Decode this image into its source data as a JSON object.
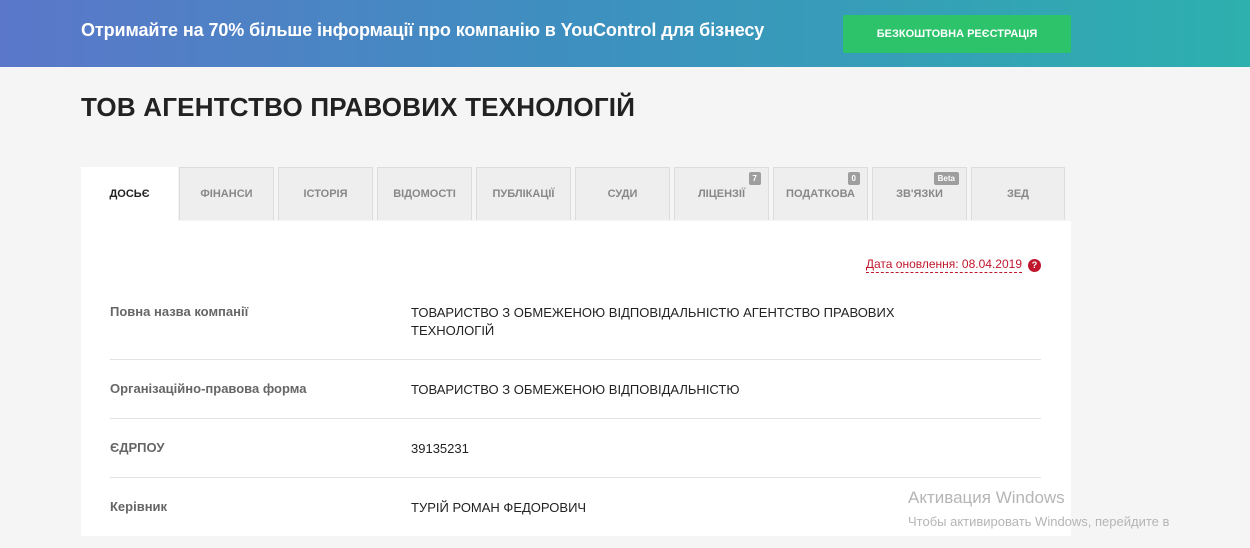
{
  "banner": {
    "text": "Отримайте на 70% більше інформації про компанію в YouControl для бізнесу",
    "button_label": "Безкоштовна реєстрація"
  },
  "company": {
    "title": "ТОВ АГЕНТСТВО ПРАВОВИХ ТЕХНОЛОГІЙ"
  },
  "tabs": [
    {
      "label": "Досьє",
      "active": true
    },
    {
      "label": "Фінанси"
    },
    {
      "label": "Історія"
    },
    {
      "label": "Відомості"
    },
    {
      "label": "Публікації"
    },
    {
      "label": "Суди"
    },
    {
      "label": "Ліцензії",
      "badge": "7"
    },
    {
      "label": "Податкова",
      "badge": "0"
    },
    {
      "label": "Зв'язки",
      "badge": "Beta"
    },
    {
      "label": "ЗЕД"
    }
  ],
  "panel": {
    "updated_text": "Дата оновлення: 08.04.2019",
    "help_glyph": "?",
    "rows": [
      {
        "label": "Повна назва компанії",
        "value": "ТОВАРИСТВО З ОБМЕЖЕНОЮ ВІДПОВІДАЛЬНІСТЮ АГЕНТСТВО ПРАВОВИХ ТЕХНОЛОГІЙ"
      },
      {
        "label": "Організаційно-правова форма",
        "value": "ТОВАРИСТВО З ОБМЕЖЕНОЮ ВІДПОВІДАЛЬНІСТЮ"
      },
      {
        "label": "ЄДРПОУ",
        "value": "39135231"
      },
      {
        "label": "Керівник",
        "value": "ТУРІЙ РОМАН ФЕДОРОВИЧ"
      }
    ]
  },
  "watermark": {
    "title": "Активация Windows",
    "text": "Чтобы активировать Windows, перейдите в"
  },
  "colors": {
    "banner_start": "#5b77c9",
    "banner_end": "#2db0ae",
    "register_button": "#2cc36b",
    "update_link": "#c0172d"
  }
}
